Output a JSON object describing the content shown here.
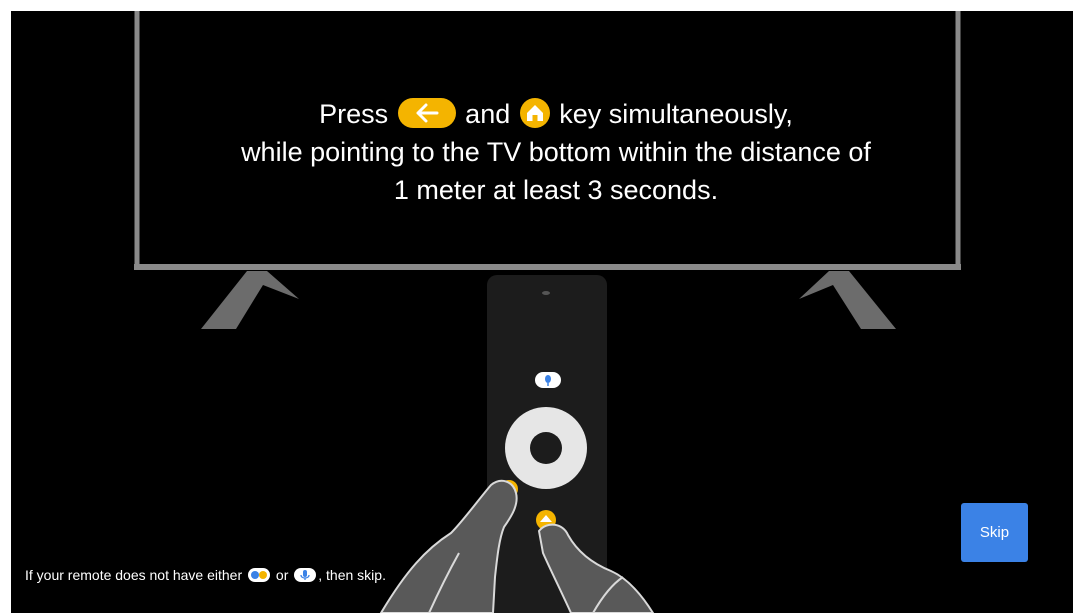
{
  "instruction": {
    "line1_press": "Press",
    "line1_and": "and",
    "line1_tail": "key simultaneously,",
    "line2": "while pointing to the TV bottom within the distance of",
    "line3": "1 meter at least 3 seconds.",
    "back_key_icon": "back-arrow-icon",
    "home_key_icon": "home-icon"
  },
  "footnote": {
    "prefix": "If your remote does not have either",
    "or": "or",
    "suffix": ", then skip.",
    "icon1": "google-assistant-icon",
    "icon2": "microphone-icon"
  },
  "skip_button": {
    "label": "Skip"
  },
  "colors": {
    "background": "#000000",
    "tv_frame": "#8a8a8a",
    "accent_yellow": "#f4b400",
    "skip_button": "#3b82e6",
    "remote_body": "#1c1c1c"
  }
}
